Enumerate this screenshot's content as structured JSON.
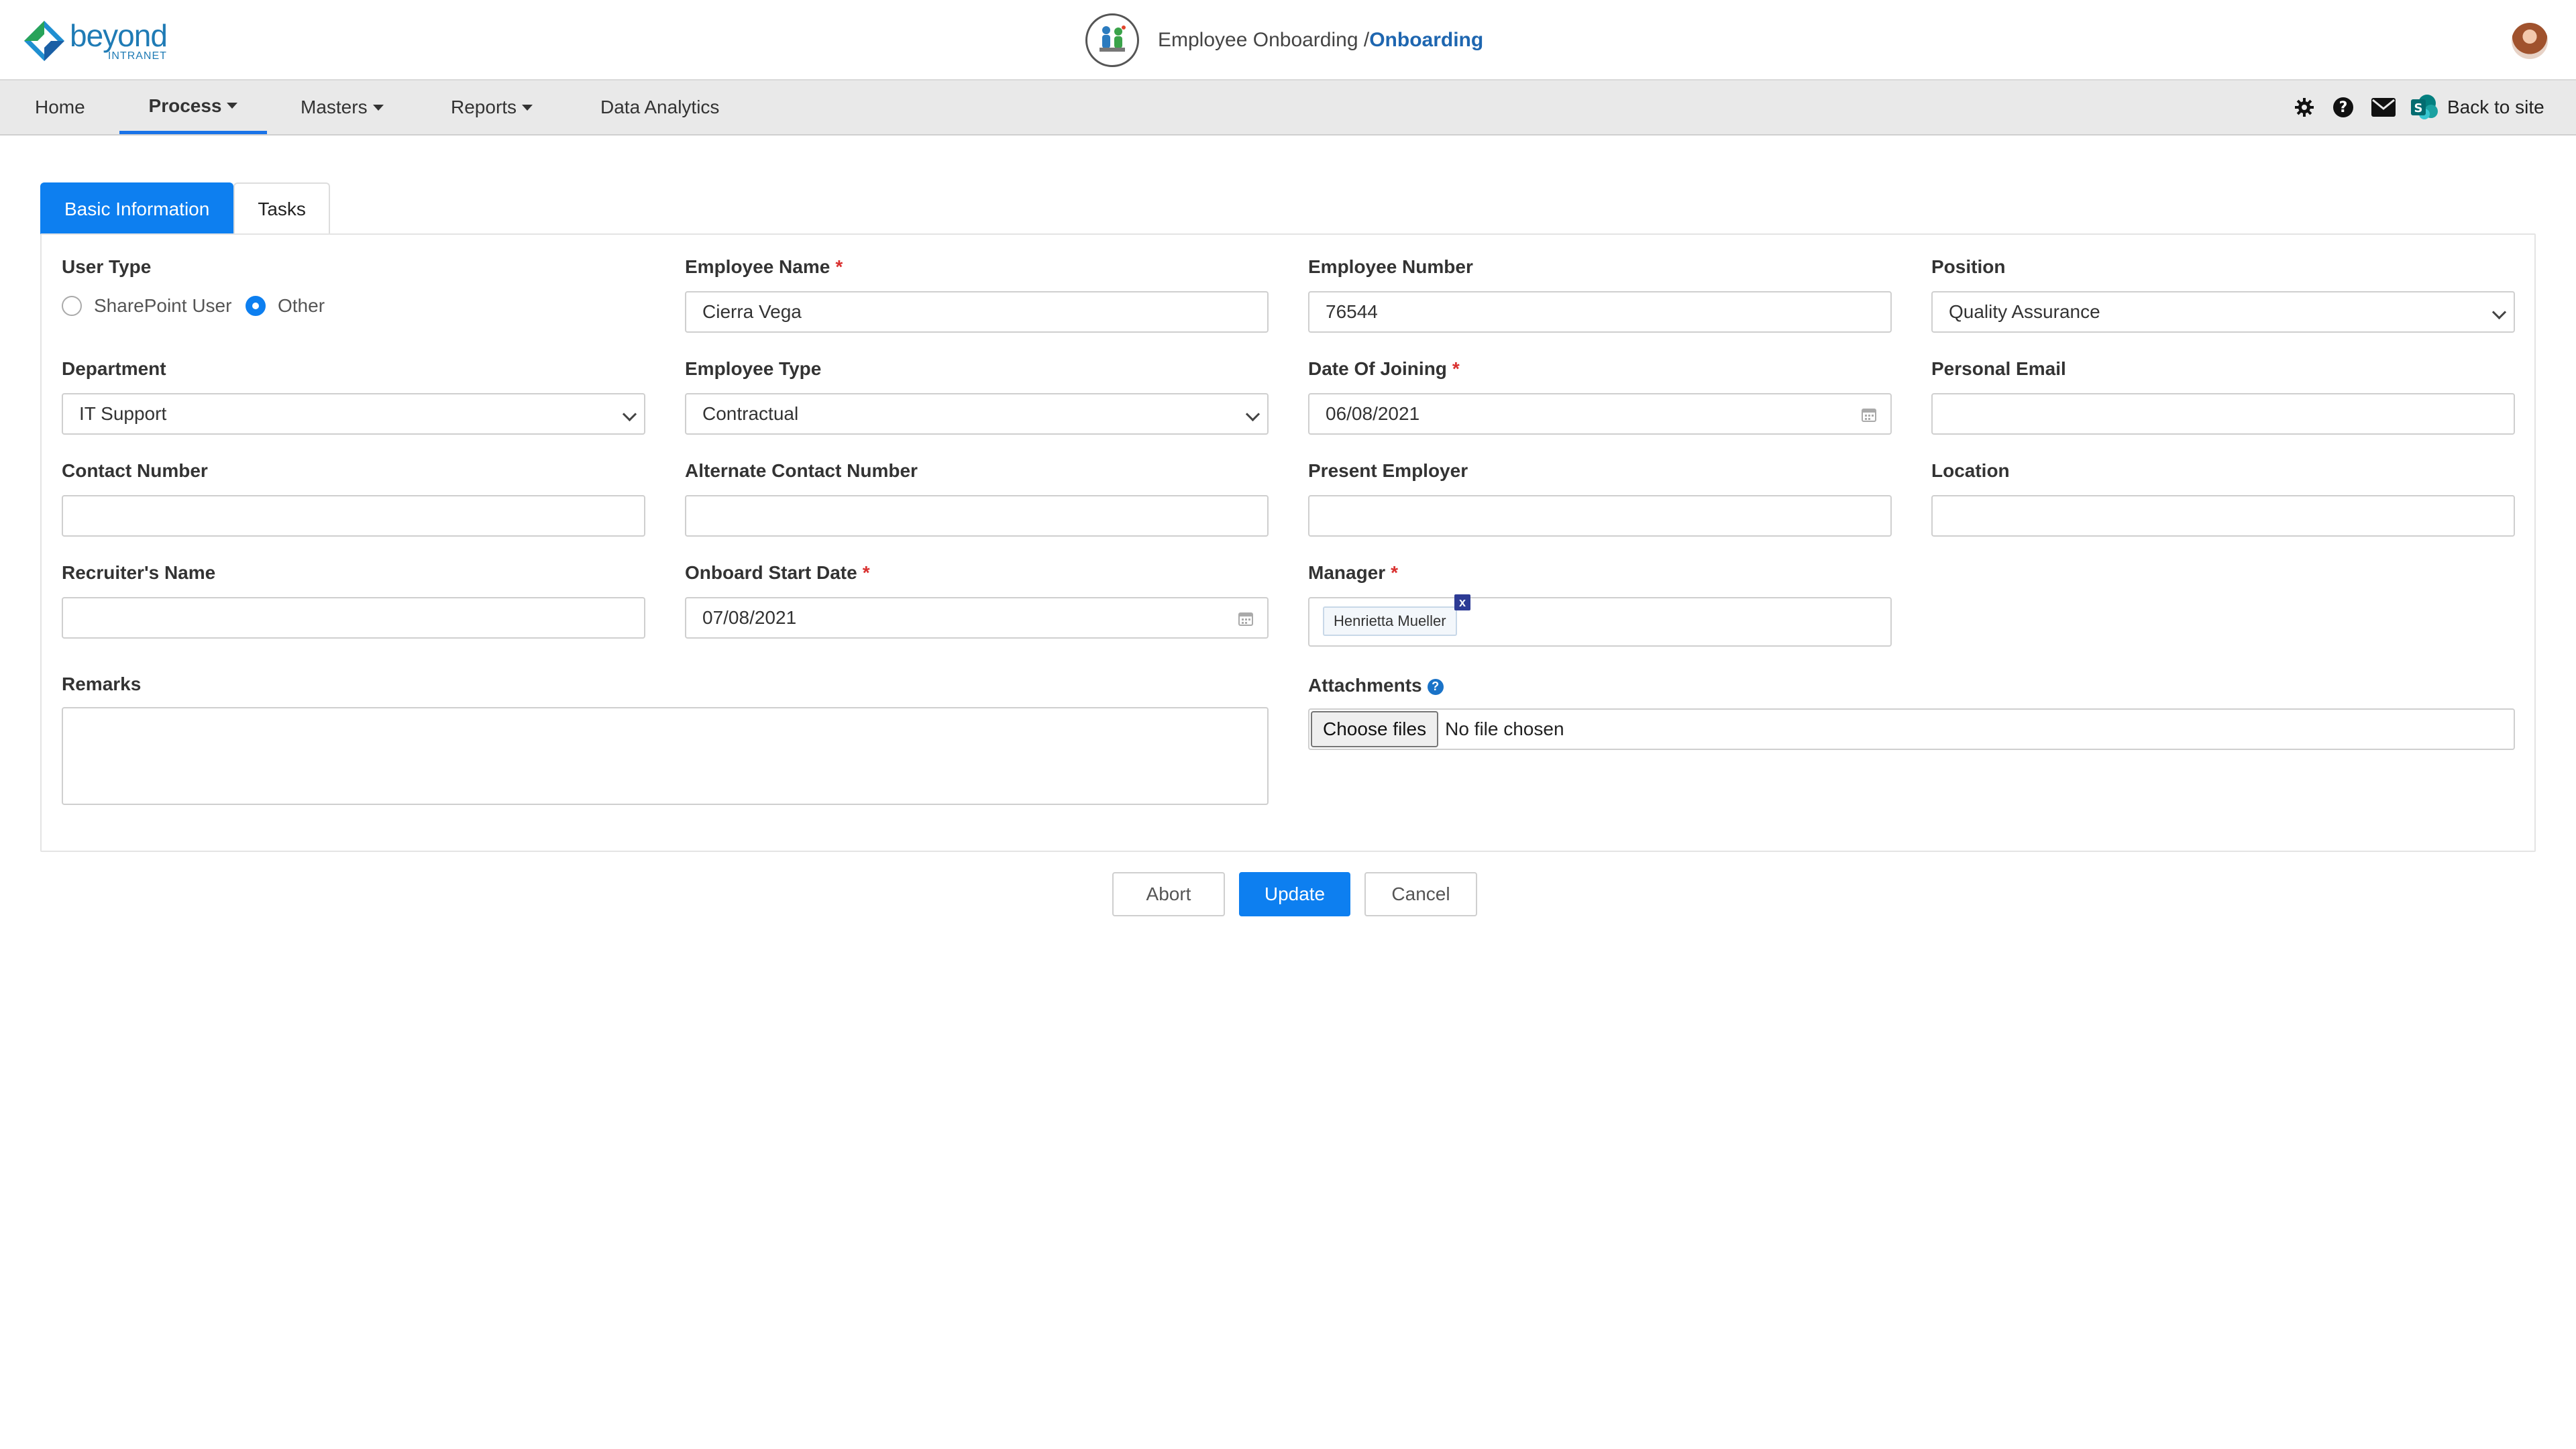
{
  "brand": {
    "name": "beyond",
    "sub": "INTRANET"
  },
  "header": {
    "title": "Employee Onboarding /",
    "crumb": "Onboarding"
  },
  "nav": {
    "items": [
      {
        "label": "Home"
      },
      {
        "label": "Process"
      },
      {
        "label": "Masters"
      },
      {
        "label": "Reports"
      },
      {
        "label": "Data Analytics"
      }
    ],
    "back_to_site": "Back to site"
  },
  "tabs": [
    {
      "label": "Basic Information"
    },
    {
      "label": "Tasks"
    }
  ],
  "form": {
    "user_type": {
      "label": "User Type",
      "options": [
        "SharePoint User",
        "Other"
      ],
      "selected": "Other"
    },
    "employee_name": {
      "label": "Employee Name",
      "value": "Cierra Vega"
    },
    "employee_number": {
      "label": "Employee Number",
      "value": "76544"
    },
    "position": {
      "label": "Position",
      "value": "Quality Assurance"
    },
    "department": {
      "label": "Department",
      "value": "IT Support"
    },
    "employee_type": {
      "label": "Employee Type",
      "value": "Contractual"
    },
    "date_of_joining": {
      "label": "Date Of Joining",
      "value": "06/08/2021"
    },
    "personal_email": {
      "label": "Personal Email",
      "value": ""
    },
    "contact_number": {
      "label": "Contact Number",
      "value": ""
    },
    "alternate_contact": {
      "label": "Alternate Contact Number",
      "value": ""
    },
    "present_employer": {
      "label": "Present Employer",
      "value": ""
    },
    "location": {
      "label": "Location",
      "value": ""
    },
    "recruiter_name": {
      "label": "Recruiter's Name",
      "value": ""
    },
    "onboard_start_date": {
      "label": "Onboard Start Date",
      "value": "07/08/2021"
    },
    "manager": {
      "label": "Manager",
      "chip": "Henrietta Mueller",
      "remove": "x"
    },
    "remarks": {
      "label": "Remarks",
      "value": ""
    },
    "attachments": {
      "label": "Attachments",
      "button": "Choose files",
      "status": "No file chosen",
      "help": "?"
    }
  },
  "actions": {
    "abort": "Abort",
    "update": "Update",
    "cancel": "Cancel"
  },
  "required_mark": "*",
  "colors": {
    "primary": "#0d7ff0",
    "required": "#d9302f",
    "crumb": "#1e66b0"
  }
}
